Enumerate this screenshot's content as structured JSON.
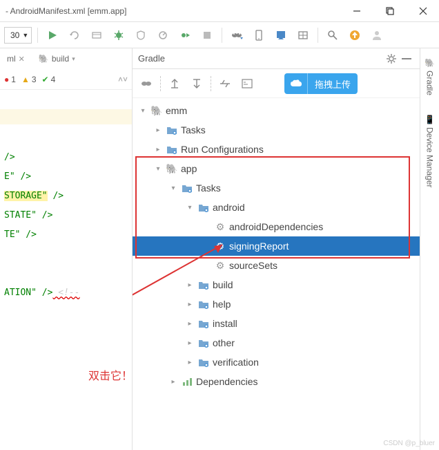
{
  "window": {
    "title": "- AndroidManifest.xml [emm.app]"
  },
  "toolbar": {
    "dropdown_value": "30"
  },
  "tabs": {
    "tab1": "ml",
    "tab2": "build"
  },
  "crumbs": {
    "err_count": "1",
    "warn_count": "3",
    "ok_count": "4"
  },
  "editor": {
    "l1": "",
    "l2": "/>",
    "l3_a": "E\"",
    "l3_b": " />",
    "l4_a": "STORAGE\"",
    "l4_b": " />",
    "l5_a": "STATE\"",
    "l5_b": " />",
    "l6_a": "TE\"",
    "l6_b": " />",
    "l7": "",
    "l8": "",
    "l9_a": "ATION\"",
    "l9_b": " />",
    "l9_c": " <!--"
  },
  "panel": {
    "title": "Gradle",
    "upload_label": "拖拽上传"
  },
  "tree": {
    "root": "emm",
    "tasks1": "Tasks",
    "runconf": "Run Configurations",
    "app": "app",
    "tasks2": "Tasks",
    "android": "android",
    "androidDeps": "androidDependencies",
    "signingReport": "signingReport",
    "sourceSets": "sourceSets",
    "build": "build",
    "help": "help",
    "install": "install",
    "other": "other",
    "verification": "verification",
    "deps": "Dependencies"
  },
  "annotation": "双击它！",
  "sidetabs": {
    "gradle": "Gradle",
    "device": "Device Manager"
  },
  "watermark": "CSDN @p_bluer"
}
